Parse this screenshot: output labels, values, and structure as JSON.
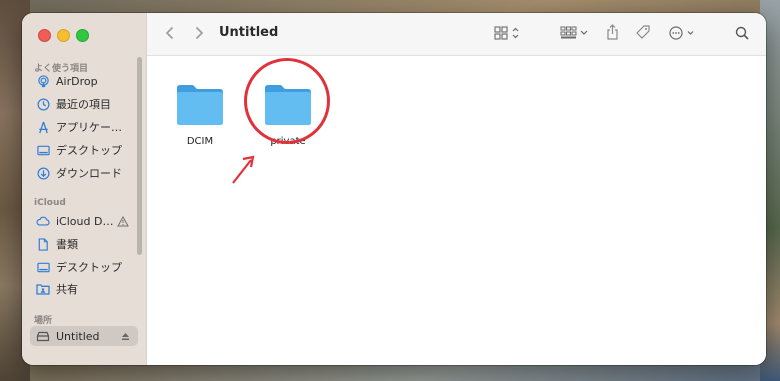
{
  "window": {
    "title": "Untitled"
  },
  "sidebar": {
    "sections": [
      {
        "title": "よく使う項目",
        "items": [
          {
            "label": "AirDrop",
            "icon": "airdrop-icon"
          },
          {
            "label": "最近の項目",
            "icon": "clock-icon"
          },
          {
            "label": "アプリケー…",
            "icon": "applications-icon"
          },
          {
            "label": "デスクトップ",
            "icon": "desktop-icon"
          },
          {
            "label": "ダウンロード",
            "icon": "download-icon"
          }
        ]
      },
      {
        "title": "iCloud",
        "items": [
          {
            "label": "iCloud D…",
            "icon": "icloud-icon",
            "warning": true
          },
          {
            "label": "書類",
            "icon": "document-icon"
          },
          {
            "label": "デスクトップ",
            "icon": "desktop-icon"
          },
          {
            "label": "共有",
            "icon": "shared-folder-icon"
          }
        ]
      },
      {
        "title": "場所",
        "items": [
          {
            "label": "Untitled",
            "icon": "drive-icon",
            "selected": true,
            "eject": true
          }
        ]
      }
    ]
  },
  "content": {
    "items": [
      {
        "name": "DCIM",
        "type": "folder"
      },
      {
        "name": "private",
        "type": "folder",
        "highlighted": true
      }
    ]
  },
  "colors": {
    "folder": "#5fb6ec",
    "highlight": "#e0323a",
    "accent": "#2f7fd6"
  }
}
